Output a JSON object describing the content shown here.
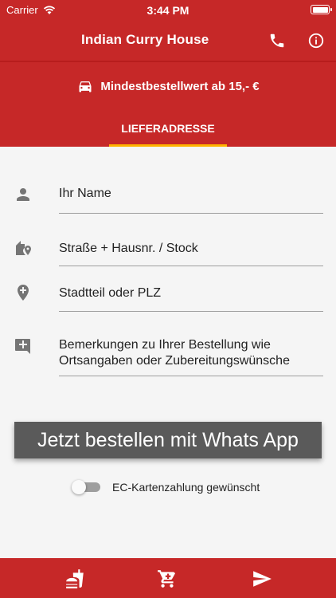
{
  "status_bar": {
    "carrier": "Carrier",
    "time": "3:44 PM"
  },
  "app_bar": {
    "title": "Indian Curry House",
    "phone_icon": "phone-icon",
    "info_icon": "info-icon"
  },
  "header": {
    "min_order": "Mindestbestellwert ab 15,- €",
    "tab_label": "LIEFERADRESSE"
  },
  "form": {
    "name_label": "Ihr Name",
    "street_label": "Straße + Hausnr. / Stock",
    "district_label": "Stadtteil oder PLZ",
    "notes_line1": "Bemerkungen zu Ihrer Bestellung wie",
    "notes_line2": "Ortsangaben oder Zubereitungswünsche"
  },
  "order_button": "Jetzt bestellen mit Whats App",
  "ec_toggle": {
    "label": "EC-Kartenzahlung gewünscht",
    "checked": false
  },
  "bottom_nav": {
    "items": [
      "fastfood-icon",
      "cart-icon",
      "send-icon"
    ]
  },
  "colors": {
    "primary": "#c62828",
    "indicator": "#ffb300",
    "button": "#5a5a5a"
  }
}
